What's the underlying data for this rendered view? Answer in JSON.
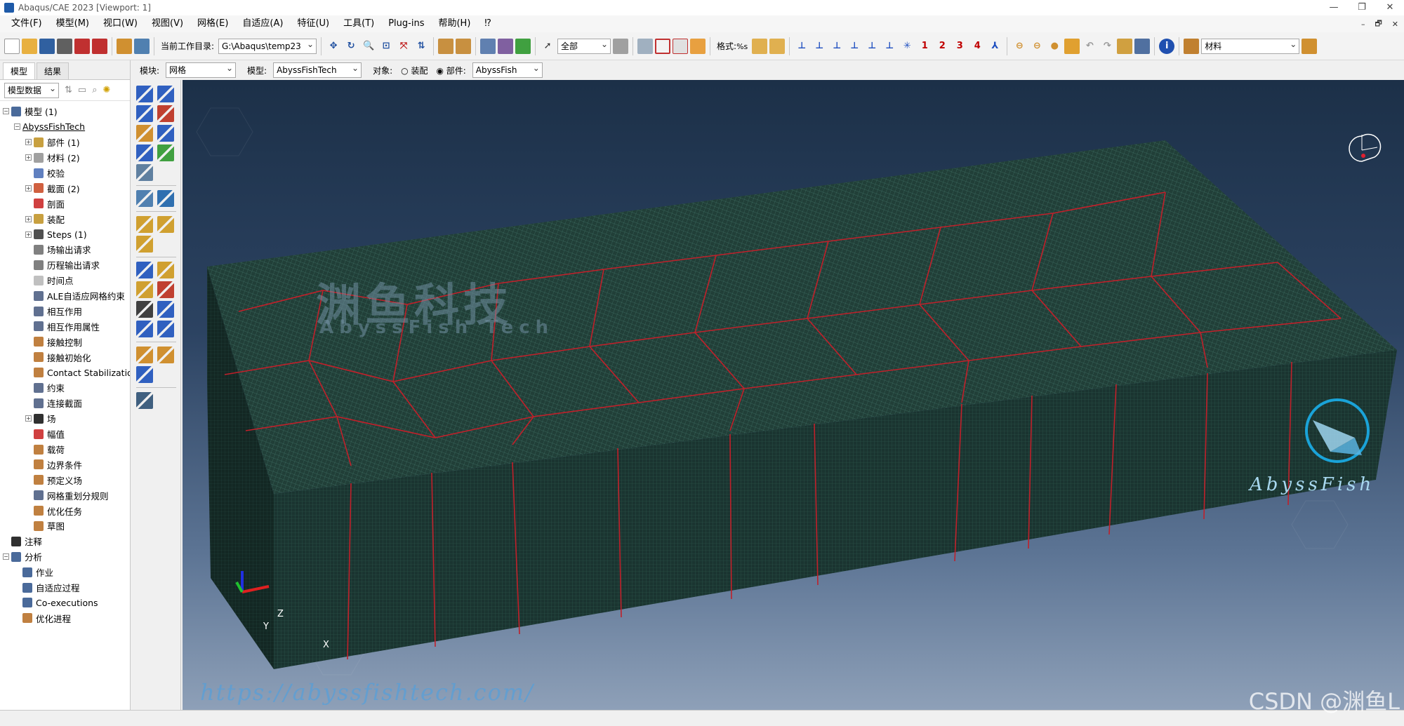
{
  "window": {
    "title": "Abaqus/CAE 2023 [Viewport: 1]",
    "controls": [
      "—",
      "❐",
      "✕"
    ],
    "mdi_controls": [
      "–",
      "🗗",
      "✕"
    ]
  },
  "menu": [
    "文件(F)",
    "模型(M)",
    "视口(W)",
    "视图(V)",
    "网格(E)",
    "自适应(A)",
    "特征(U)",
    "工具(T)",
    "Plug-ins",
    "帮助(H)",
    "⁉"
  ],
  "toolbar": {
    "workdir_label": "当前工作目录:",
    "workdir_value": "G:\\Abaqus\\temp23",
    "selection_value": "全部",
    "format_label": "格式:",
    "format_value": "%s",
    "csys_numbers": [
      "1",
      "2",
      "3",
      "4"
    ],
    "material_value": "材料"
  },
  "context": {
    "module_label": "模块:",
    "module_value": "网格",
    "model_label": "模型:",
    "model_value": "AbyssFishTech",
    "object_label": "对象:",
    "assembly_label": "装配",
    "part_label": "部件:",
    "part_value": "AbyssFish"
  },
  "left_panel": {
    "tabs": [
      "模型",
      "结果"
    ],
    "tree_combo": "模型数据",
    "tree": [
      {
        "label": "模型 (1)",
        "level": 0,
        "exp": "−",
        "icon": "#4a6a9a"
      },
      {
        "label": "AbyssFishTech",
        "level": 1,
        "exp": "−",
        "icon": "",
        "link": true
      },
      {
        "label": "部件 (1)",
        "level": 2,
        "exp": "+",
        "icon": "#c8a040"
      },
      {
        "label": "材料 (2)",
        "level": 2,
        "exp": "+",
        "icon": "#a0a0a0"
      },
      {
        "label": "校验",
        "level": 2,
        "exp": "",
        "icon": "#6080c0"
      },
      {
        "label": "截面 (2)",
        "level": 2,
        "exp": "+",
        "icon": "#d06040"
      },
      {
        "label": "剖面",
        "level": 2,
        "exp": "",
        "icon": "#d04040"
      },
      {
        "label": "装配",
        "level": 2,
        "exp": "+",
        "icon": "#c8a040"
      },
      {
        "label": "Steps (1)",
        "level": 2,
        "exp": "+",
        "icon": "#505050"
      },
      {
        "label": "场输出请求",
        "level": 2,
        "exp": "",
        "icon": "#808080"
      },
      {
        "label": "历程输出请求",
        "level": 2,
        "exp": "",
        "icon": "#808080"
      },
      {
        "label": "时间点",
        "level": 2,
        "exp": "",
        "icon": "#c0c0c0"
      },
      {
        "label": "ALE自适应网格约束",
        "level": 2,
        "exp": "",
        "icon": "#607090"
      },
      {
        "label": "相互作用",
        "level": 2,
        "exp": "",
        "icon": "#607090"
      },
      {
        "label": "相互作用属性",
        "level": 2,
        "exp": "",
        "icon": "#607090"
      },
      {
        "label": "接触控制",
        "level": 2,
        "exp": "",
        "icon": "#c08040"
      },
      {
        "label": "接触初始化",
        "level": 2,
        "exp": "",
        "icon": "#c08040"
      },
      {
        "label": "Contact Stabilizations",
        "level": 2,
        "exp": "",
        "icon": "#c08040"
      },
      {
        "label": "约束",
        "level": 2,
        "exp": "",
        "icon": "#607090"
      },
      {
        "label": "连接截面",
        "level": 2,
        "exp": "",
        "icon": "#607090"
      },
      {
        "label": "场",
        "level": 2,
        "exp": "+",
        "icon": "#303030"
      },
      {
        "label": "幅值",
        "level": 2,
        "exp": "",
        "icon": "#d04040"
      },
      {
        "label": "载荷",
        "level": 2,
        "exp": "",
        "icon": "#c08040"
      },
      {
        "label": "边界条件",
        "level": 2,
        "exp": "",
        "icon": "#c08040"
      },
      {
        "label": "预定义场",
        "level": 2,
        "exp": "",
        "icon": "#c08040"
      },
      {
        "label": "网格重划分规则",
        "level": 2,
        "exp": "",
        "icon": "#607090"
      },
      {
        "label": "优化任务",
        "level": 2,
        "exp": "",
        "icon": "#c08040"
      },
      {
        "label": "草图",
        "level": 2,
        "exp": "",
        "icon": "#c08040"
      },
      {
        "label": "注释",
        "level": 0,
        "exp": "",
        "icon": "#303030"
      },
      {
        "label": "分析",
        "level": 0,
        "exp": "−",
        "icon": "#4a6a9a"
      },
      {
        "label": "作业",
        "level": 1,
        "exp": "",
        "icon": "#4a6a9a"
      },
      {
        "label": "自适应过程",
        "level": 1,
        "exp": "",
        "icon": "#4a6a9a"
      },
      {
        "label": "Co-executions",
        "level": 1,
        "exp": "",
        "icon": "#4a6a9a"
      },
      {
        "label": "优化进程",
        "level": 1,
        "exp": "",
        "icon": "#c08040"
      }
    ]
  },
  "viewport": {
    "watermark_cn": "渊鱼科技",
    "watermark_en": "AbyssFish Tech",
    "logo_text": "AbyssFish",
    "url_watermark": "https://abyssfishtech.com/",
    "csdn_watermark": "CSDN @渊鱼L",
    "triad_labels": {
      "x": "X",
      "y": "Y",
      "z": "Z"
    },
    "mesh_color": "#1e3c36",
    "grain_boundary_color": "#c0202a"
  }
}
